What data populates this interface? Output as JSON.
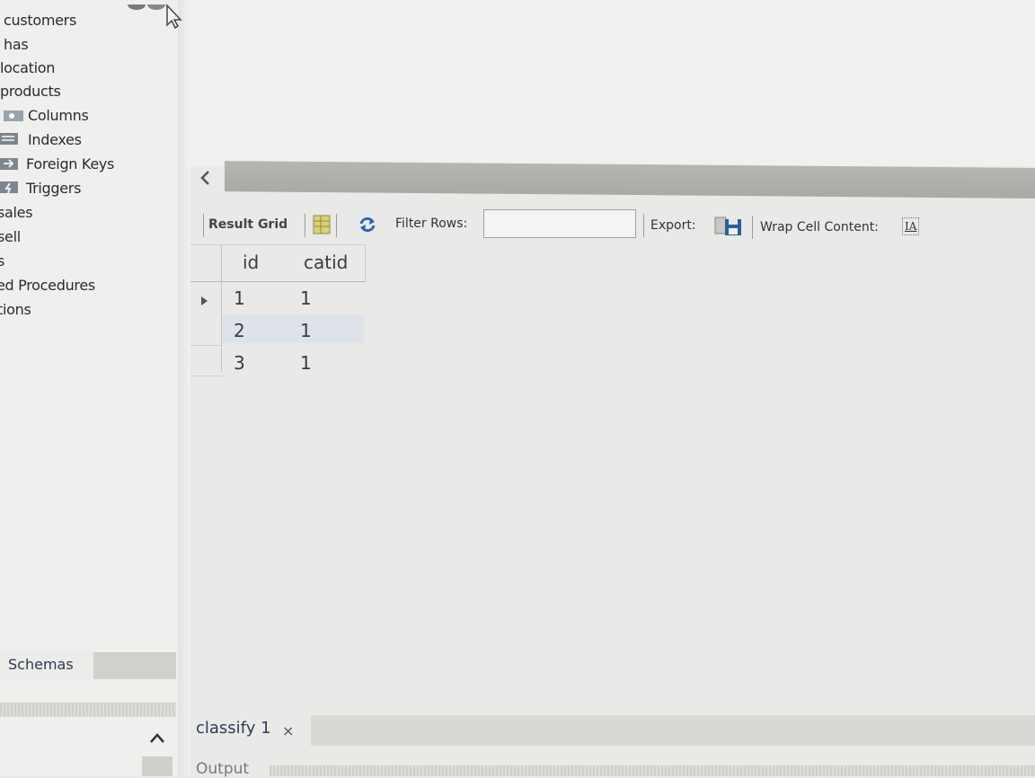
{
  "schema_tree": {
    "items": [
      {
        "label": "customers"
      },
      {
        "label": "has"
      },
      {
        "label": "location"
      },
      {
        "label": "products"
      },
      {
        "label": "Columns"
      },
      {
        "label": "Indexes"
      },
      {
        "label": "Foreign Keys"
      },
      {
        "label": "Triggers"
      },
      {
        "label": "sales"
      },
      {
        "label": "sell"
      },
      {
        "label": "s"
      },
      {
        "label": "ed Procedures"
      },
      {
        "label": "tions"
      }
    ]
  },
  "left_tabs": {
    "schemas_label": "Schemas"
  },
  "results_toolbar": {
    "result_grid_label": "Result Grid",
    "filter_rows_label": "Filter Rows:",
    "filter_rows_value": "",
    "export_label": "Export:",
    "wrap_cell_label": "Wrap Cell Content:",
    "wrap_icon_glyph": "IA"
  },
  "result_grid": {
    "columns": [
      "id",
      "catid"
    ],
    "rows": [
      [
        "1",
        "1"
      ],
      [
        "2",
        "1"
      ],
      [
        "3",
        "1"
      ]
    ]
  },
  "bottom_tabs": {
    "query_tab_label": "classify 1",
    "query_tab_close": "×",
    "output_label": "Output"
  },
  "colors": {
    "selected_row": "#dee3ea",
    "scrollbar": "#b0b0ac",
    "tab_text": "#2d3c57"
  }
}
